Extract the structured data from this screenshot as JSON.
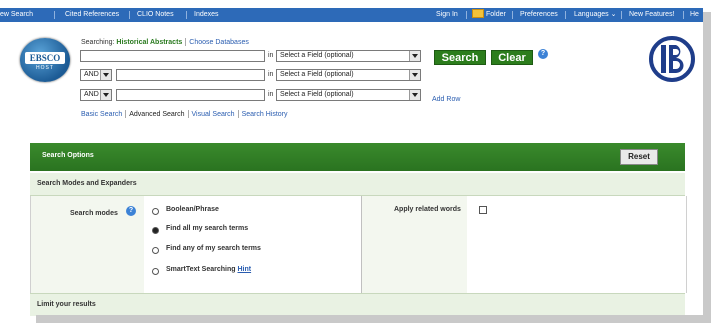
{
  "topnav": {
    "left": [
      "ew Search",
      "Cited References",
      "CLIO Notes",
      "Indexes"
    ],
    "signin": "Sign In",
    "folder": "Folder",
    "preferences": "Preferences",
    "languages": "Languages ⌄",
    "new_features": "New Features!",
    "help": "He"
  },
  "logo": {
    "text": "EBSCO",
    "sub": "HOST"
  },
  "searching": {
    "label": "Searching:",
    "database": "Historical Abstracts",
    "choose": "Choose Databases"
  },
  "search_rows": {
    "in_label": "in",
    "field_placeholder": "Select a Field (optional)",
    "operators": [
      "AND",
      "AND"
    ]
  },
  "buttons": {
    "search": "Search",
    "clear": "Clear",
    "help": "?"
  },
  "add_row": "Add Row",
  "links": [
    "Basic Search",
    "Advanced Search",
    "Visual Search",
    "Search History"
  ],
  "options": {
    "title": "Search Options",
    "reset": "Reset",
    "modes_header": "Search Modes and Expanders",
    "modes_label": "Search modes",
    "modes": [
      {
        "label": "Boolean/Phrase",
        "selected": false
      },
      {
        "label": "Find all my search terms",
        "selected": true
      },
      {
        "label": "Find any of my search terms",
        "selected": false
      },
      {
        "label": "SmartText Searching",
        "selected": false
      }
    ],
    "hint": "Hint",
    "related_words": "Apply related words",
    "limit_header": "Limit your results"
  },
  "colors": {
    "nav": "#2d6ab8",
    "green": "#2c7d1c",
    "link": "#2a5db0"
  }
}
